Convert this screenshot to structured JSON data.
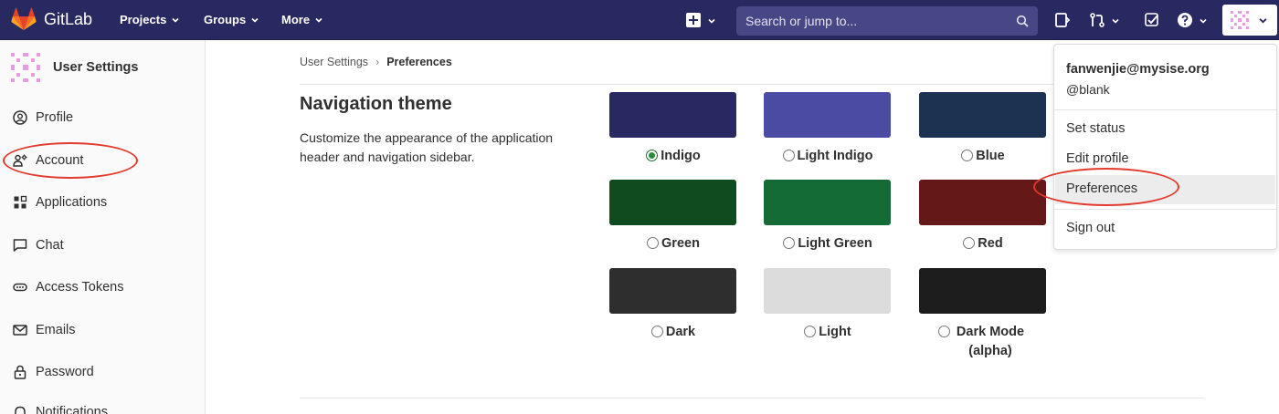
{
  "header": {
    "brand": "GitLab",
    "nav": [
      {
        "label": "Projects"
      },
      {
        "label": "Groups"
      },
      {
        "label": "More"
      }
    ],
    "search_placeholder": "Search or jump to...",
    "accent": "#292961"
  },
  "sidebar": {
    "title": "User Settings",
    "items": [
      {
        "label": "Profile",
        "icon": "profile-icon"
      },
      {
        "label": "Account",
        "icon": "account-icon"
      },
      {
        "label": "Applications",
        "icon": "applications-icon"
      },
      {
        "label": "Chat",
        "icon": "chat-icon"
      },
      {
        "label": "Access Tokens",
        "icon": "token-icon"
      },
      {
        "label": "Emails",
        "icon": "mail-icon"
      },
      {
        "label": "Password",
        "icon": "lock-icon"
      },
      {
        "label": "Notifications",
        "icon": "bell-icon"
      }
    ]
  },
  "breadcrumb": {
    "parent": "User Settings",
    "separator": "›",
    "current": "Preferences"
  },
  "section": {
    "title": "Navigation theme",
    "description": "Customize the appearance of the application header and navigation sidebar."
  },
  "themes": [
    {
      "label": "Indigo",
      "color": "#292961",
      "selected": true
    },
    {
      "label": "Light Indigo",
      "color": "#4b4ba3",
      "selected": false
    },
    {
      "label": "Blue",
      "color": "#1b3250",
      "selected": false
    },
    {
      "label": "Green",
      "color": "#0f4b1f",
      "selected": false
    },
    {
      "label": "Light Green",
      "color": "#156b35",
      "selected": false
    },
    {
      "label": "Red",
      "color": "#641818",
      "selected": false
    },
    {
      "label": "Dark",
      "color": "#2e2e2e",
      "selected": false
    },
    {
      "label": "Light",
      "color": "#dcdcdc",
      "selected": false
    },
    {
      "label": "Dark Mode (alpha)",
      "color": "#1d1d1d",
      "selected": false
    }
  ],
  "user_menu": {
    "email": "fanwenjie@mysise.org",
    "username": "@blank",
    "items": [
      {
        "label": "Set status"
      },
      {
        "label": "Edit profile"
      },
      {
        "label": "Preferences"
      },
      {
        "label": "Sign out"
      }
    ]
  },
  "annotation_color": "#e23a2e"
}
